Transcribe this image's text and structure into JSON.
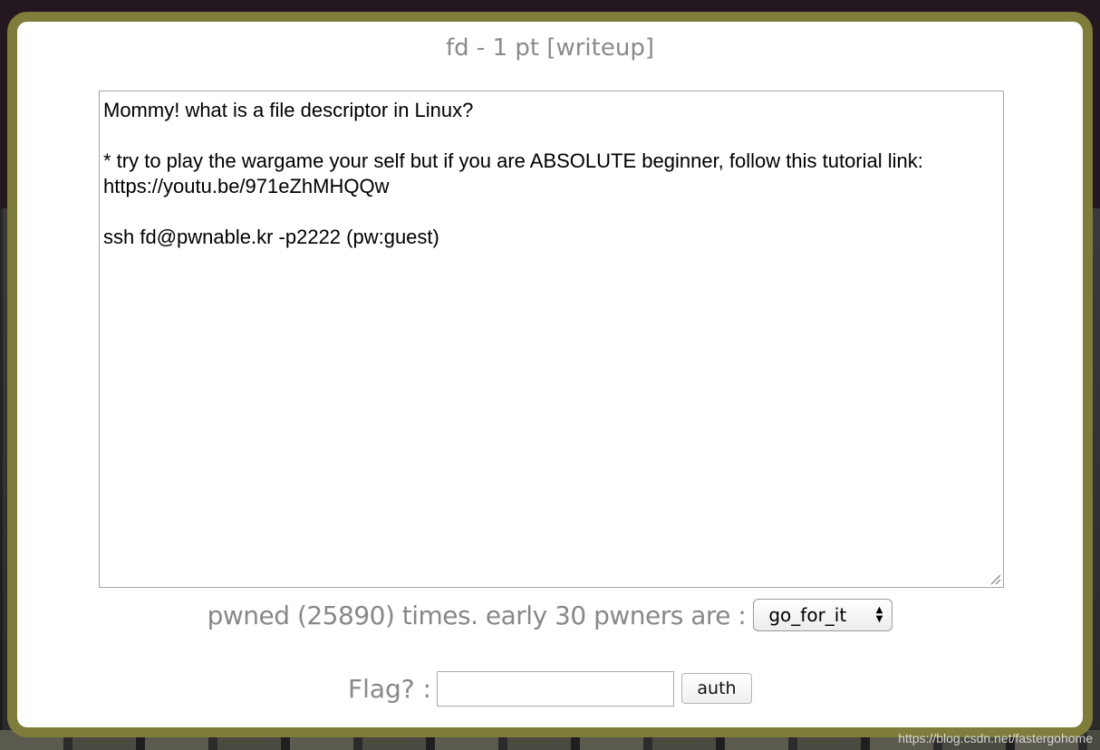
{
  "challenge": {
    "title": "fd - 1 pt [writeup]",
    "description": "Mommy! what is a file descriptor in Linux?\n\n* try to play the wargame your self but if you are ABSOLUTE beginner, follow this tutorial link:\nhttps://youtu.be/971eZhMHQQw\n\nssh fd@pwnable.kr -p2222 (pw:guest)"
  },
  "stats": {
    "pwned_text": "pwned (25890) times. early 30 pwners are :",
    "selected_pwner": "go_for_it"
  },
  "flag_form": {
    "label": "Flag? :",
    "input_value": "",
    "submit_label": "auth"
  },
  "watermark": "https://blog.csdn.net/fastergohome",
  "colors": {
    "frame": "#7f7d3b",
    "muted_text": "#888888"
  },
  "icons": {
    "resize_grip": "resize-grip-icon",
    "select_arrows": "up-down-arrows-icon"
  }
}
